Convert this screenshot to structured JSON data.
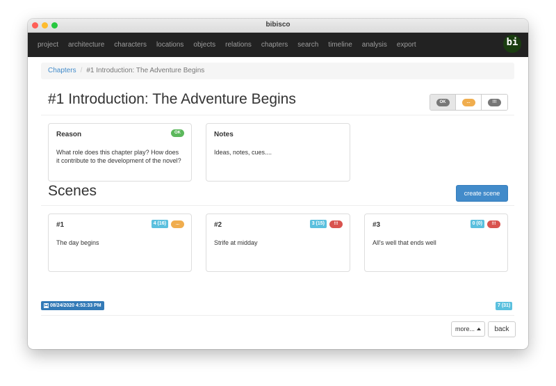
{
  "window": {
    "title": "bibisco"
  },
  "navbar": {
    "items": [
      "project",
      "architecture",
      "characters",
      "locations",
      "objects",
      "relations",
      "chapters",
      "search",
      "timeline",
      "analysis",
      "export"
    ],
    "logo": "bi"
  },
  "breadcrumb": {
    "parent": "Chapters",
    "separator": "/",
    "current": "#1 Introduction: The Adventure Begins"
  },
  "page": {
    "title": "#1 Introduction: The Adventure Begins"
  },
  "status_buttons": {
    "ok": "OK",
    "partial": "...",
    "todo": "!!!"
  },
  "reason": {
    "title": "Reason",
    "status": "OK",
    "text": "What role does this chapter play? How does it contribute to the development of the novel?"
  },
  "notes": {
    "title": "Notes",
    "text": "Ideas, notes, cues...."
  },
  "scenes": {
    "title": "Scenes",
    "create_label": "create scene",
    "items": [
      {
        "number": "#1",
        "count": "4 (16)",
        "status": "...",
        "text": "The day begins"
      },
      {
        "number": "#2",
        "count": "3 (15)",
        "status": "!!!",
        "text": "Strife at midday"
      },
      {
        "number": "#3",
        "count": "0 (0)",
        "status": "!!!",
        "text": "All's well that ends well"
      }
    ]
  },
  "footer": {
    "saved_at": "08/24/2020 4:53:33 PM",
    "total_count": "7 (31)",
    "more_label": "more...",
    "back_label": "back"
  },
  "colors": {
    "navbar_bg": "#222222",
    "primary": "#428bca",
    "info": "#5bc0de",
    "success": "#5cb85c",
    "warning": "#f0ad4e",
    "danger": "#d9534f"
  }
}
